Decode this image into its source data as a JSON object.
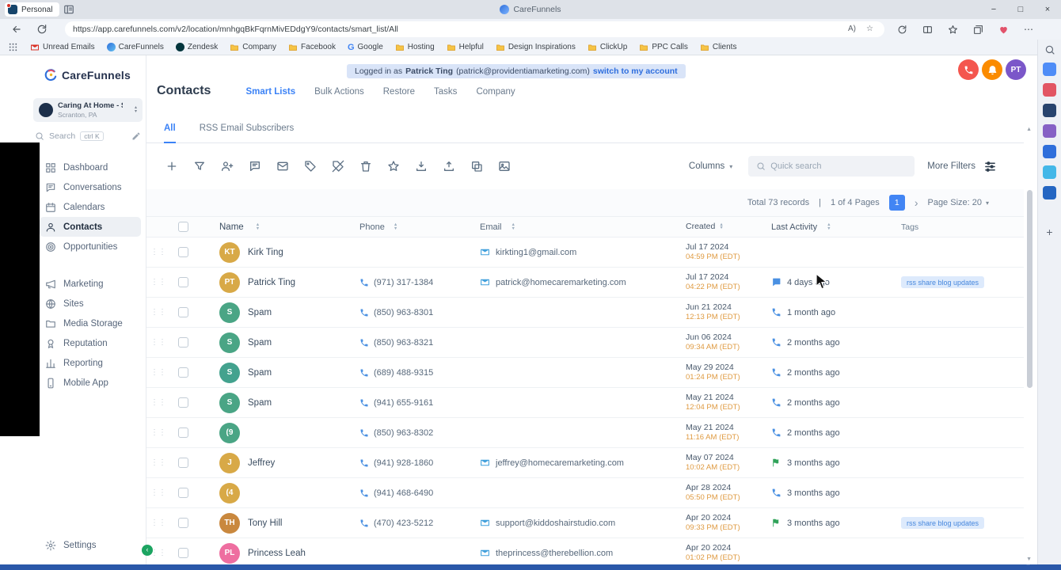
{
  "browser": {
    "profile_label": "Personal",
    "tab_title": "CareFunnels",
    "url": "https://app.carefunnels.com/v2/location/mnhgqBkFqrnMivEDdgY9/contacts/smart_list/All",
    "bookmarks": [
      {
        "label": "Unread Emails",
        "icon": "mail"
      },
      {
        "label": "CareFunnels",
        "icon": "site"
      },
      {
        "label": "Zendesk",
        "icon": "zendesk"
      },
      {
        "label": "Company",
        "icon": "folder"
      },
      {
        "label": "Facebook",
        "icon": "folder"
      },
      {
        "label": "Google",
        "icon": "google"
      },
      {
        "label": "Hosting",
        "icon": "folder"
      },
      {
        "label": "Helpful",
        "icon": "folder"
      },
      {
        "label": "Design Inspirations",
        "icon": "folder"
      },
      {
        "label": "ClickUp",
        "icon": "folder"
      },
      {
        "label": "PPC Calls",
        "icon": "folder"
      },
      {
        "label": "Clients",
        "icon": "folder"
      }
    ]
  },
  "edge_rail": {
    "app_colors": [
      "#4f8df7",
      "#e25563",
      "#28446e",
      "#8661c5",
      "#2f6fdb",
      "#43b7e8",
      "#2466c2"
    ]
  },
  "sidebar": {
    "brand": "CareFunnels",
    "location": {
      "name": "Caring At Home - Sn...",
      "city": "Scranton, PA"
    },
    "search_label": "Search",
    "search_shortcut": "ctrl K",
    "menu": [
      {
        "label": "Dashboard",
        "icon": "grid"
      },
      {
        "label": "Conversations",
        "icon": "chat"
      },
      {
        "label": "Calendars",
        "icon": "calendar"
      },
      {
        "label": "Contacts",
        "icon": "user",
        "active": true
      },
      {
        "label": "Opportunities",
        "icon": "target"
      },
      {
        "label": "Marketing",
        "icon": "megaphone",
        "section_gap": true
      },
      {
        "label": "Sites",
        "icon": "globe"
      },
      {
        "label": "Media Storage",
        "icon": "folder"
      },
      {
        "label": "Reputation",
        "icon": "medal"
      },
      {
        "label": "Reporting",
        "icon": "bars"
      },
      {
        "label": "Mobile App",
        "icon": "smartphone"
      }
    ],
    "settings_label": "Settings"
  },
  "header": {
    "banner_prefix": "Logged in as",
    "banner_name": "Patrick Ting",
    "banner_email": "(patrick@providentiamarketing.com)",
    "banner_action": "switch to my account",
    "avatar_initials": "PT",
    "title": "Contacts",
    "tabs": [
      {
        "label": "Smart Lists",
        "active": true
      },
      {
        "label": "Bulk Actions"
      },
      {
        "label": "Restore"
      },
      {
        "label": "Tasks"
      },
      {
        "label": "Company"
      }
    ],
    "subtabs": [
      {
        "label": "All",
        "active": true
      },
      {
        "label": "RSS Email Subscribers"
      }
    ]
  },
  "toolbar": {
    "icons": [
      "plus",
      "filter",
      "user-plus",
      "chat",
      "mail",
      "tag",
      "tag-off",
      "trash",
      "star",
      "download",
      "upload",
      "copy",
      "image"
    ],
    "columns_label": "Columns",
    "search_placeholder": "Quick search",
    "more_filters_label": "More Filters"
  },
  "pagination": {
    "records": "Total 73 records",
    "sep": "|",
    "pages": "1 of 4 Pages",
    "page": "1",
    "page_size": "Page Size: 20"
  },
  "table": {
    "headers": [
      {
        "label": "Name",
        "sortable": true
      },
      {
        "label": "Phone",
        "sortable": true
      },
      {
        "label": "Email",
        "sortable": true
      },
      {
        "label": "Created",
        "sortable": true
      },
      {
        "label": "Last Activity",
        "sortable": true
      },
      {
        "label": "Tags",
        "sortable": false
      }
    ],
    "rows": [
      {
        "initials": "KT",
        "avatar_color": "#d8a947",
        "name": "Kirk Ting",
        "phone": "",
        "email": "kirkting1@gmail.com",
        "created_date": "Jul 17 2024",
        "created_time": "04:59 PM (EDT)",
        "activity": "",
        "activity_icon": "",
        "tags": []
      },
      {
        "initials": "PT",
        "avatar_color": "#d8a947",
        "name": "Patrick Ting",
        "phone": "(971) 317-1384",
        "email": "patrick@homecaremarketing.com",
        "created_date": "Jul 17 2024",
        "created_time": "04:22 PM (EDT)",
        "activity": "4 days ago",
        "activity_icon": "message",
        "tags": [
          "rss share blog updates"
        ]
      },
      {
        "initials": "S",
        "avatar_color": "#4aa585",
        "name": "Spam",
        "phone": "(850) 963-8301",
        "email": "",
        "created_date": "Jun 21 2024",
        "created_time": "12:13 PM (EDT)",
        "activity": "1 month ago",
        "activity_icon": "phone",
        "tags": []
      },
      {
        "initials": "S",
        "avatar_color": "#4aa585",
        "name": "Spam",
        "phone": "(850) 963-8321",
        "email": "",
        "created_date": "Jun 06 2024",
        "created_time": "09:34 AM (EDT)",
        "activity": "2 months ago",
        "activity_icon": "phone",
        "tags": []
      },
      {
        "initials": "S",
        "avatar_color": "#43a28e",
        "name": "Spam",
        "phone": "(689) 488-9315",
        "email": "",
        "created_date": "May 29 2024",
        "created_time": "01:24 PM (EDT)",
        "activity": "2 months ago",
        "activity_icon": "phone",
        "tags": []
      },
      {
        "initials": "S",
        "avatar_color": "#4aa585",
        "name": "Spam",
        "phone": "(941) 655-9161",
        "email": "",
        "created_date": "May 21 2024",
        "created_time": "12:04 PM (EDT)",
        "activity": "2 months ago",
        "activity_icon": "phone",
        "tags": []
      },
      {
        "initials": "(9",
        "avatar_color": "#4aa585",
        "name": "",
        "phone": "(850) 963-8302",
        "email": "",
        "created_date": "May 21 2024",
        "created_time": "11:16 AM (EDT)",
        "activity": "2 months ago",
        "activity_icon": "phone",
        "tags": []
      },
      {
        "initials": "J",
        "avatar_color": "#d8a947",
        "name": "Jeffrey",
        "phone": "(941) 928-1860",
        "email": "jeffrey@homecaremarketing.com",
        "created_date": "May 07 2024",
        "created_time": "10:02 AM (EDT)",
        "activity": "3 months ago",
        "activity_icon": "flag",
        "tags": []
      },
      {
        "initials": "(4",
        "avatar_color": "#d8a947",
        "name": "",
        "phone": "(941) 468-6490",
        "email": "",
        "created_date": "Apr 28 2024",
        "created_time": "05:50 PM (EDT)",
        "activity": "3 months ago",
        "activity_icon": "phone",
        "tags": []
      },
      {
        "initials": "TH",
        "avatar_color": "#c9883e",
        "name": "Tony Hill",
        "phone": "(470) 423-5212",
        "email": "support@kiddoshairstudio.com",
        "created_date": "Apr 20 2024",
        "created_time": "09:33 PM (EDT)",
        "activity": "3 months ago",
        "activity_icon": "flag",
        "tags": [
          "rss share blog updates"
        ]
      },
      {
        "initials": "PL",
        "avatar_color": "#ee6ea0",
        "name": "Princess Leah",
        "phone": "",
        "email": "theprincess@therebellion.com",
        "created_date": "Apr 20 2024",
        "created_time": "01:02 PM (EDT)",
        "activity": "",
        "activity_icon": "",
        "tags": []
      }
    ]
  },
  "colors": {
    "accent": "#3b82f6",
    "banner_bg": "#d9e4f8",
    "page_button": "#4285f4",
    "time_text": "#df9a40",
    "tag_bg": "#ddeafc",
    "tag_text": "#4687dd",
    "phone_circle": "#f4564e",
    "bell_circle": "#fb8b00",
    "avatar_circle": "#7b57c9"
  }
}
